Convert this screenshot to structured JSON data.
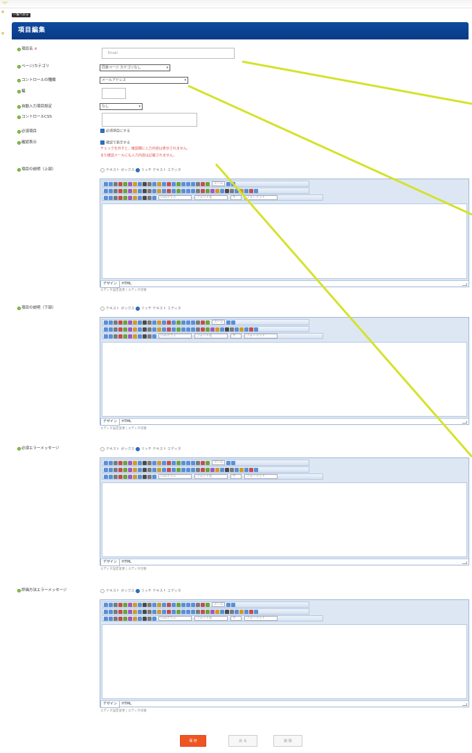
{
  "breadcrumb": "一覧へ戻る",
  "panel_title": "項目編集",
  "fields": {
    "item_name": {
      "label": "項目名",
      "required_mark": "※",
      "value": "Email"
    },
    "page_category": {
      "label": "ページ/カテゴリ",
      "value": "同意ページ カテゴリなし"
    },
    "control_type": {
      "label": "コントロールの種類",
      "value": "メールアドレス"
    },
    "width": {
      "label": "幅",
      "value": ""
    },
    "auto_input": {
      "label": "自動入力項目設定",
      "value": "なし"
    },
    "control_css": {
      "label": "コントロールCSS",
      "value": ""
    },
    "required": {
      "label": "必須項目",
      "option": "必須項目にする"
    },
    "confirm_input": {
      "label": "確認表示",
      "option": "確認で表示する",
      "warnings": [
        "チェックを外すと、確認欄に入力内容は表示されません。",
        "また確認メールにも入力内容は記載されません。"
      ]
    }
  },
  "editors": [
    {
      "label": "項目の説明（上部）",
      "radio_text": "テキスト ボックス",
      "radio_rich": "リッチ テキスト エディタ",
      "sub": "エディタ設定変更 | エディタ切替"
    },
    {
      "label": "項目の説明（下部）",
      "radio_text": "テキスト ボックス",
      "radio_rich": "リッチ テキスト エディタ",
      "sub": "エディタ設定変更 | エディタ切替"
    },
    {
      "label": "必須エラーメッセージ",
      "radio_text": "テキスト ボックス",
      "radio_rich": "リッチ テキスト エディタ",
      "sub": "エディタ設定変更 | エディタ切替"
    },
    {
      "label": "評価方法エラーメッセージ",
      "radio_text": "テキスト ボックス",
      "radio_rich": "リッチ テキスト エディタ",
      "sub": "エディタ設定変更 | エディタ切替"
    }
  ],
  "toolbar": {
    "zoom": "ズーム",
    "css_class": "CSSクラス",
    "font": "フォント名",
    "size": "サ",
    "format": "フォーマット"
  },
  "modes": {
    "design": "デザイン",
    "html": "HTML"
  },
  "buttons": {
    "save": "保 存",
    "back": "戻 る",
    "delete": "削 除"
  },
  "colors": {
    "header": "#0f4a9e",
    "save": "#ee5522",
    "annotation": "#d4e22a",
    "required": "#e04040"
  }
}
